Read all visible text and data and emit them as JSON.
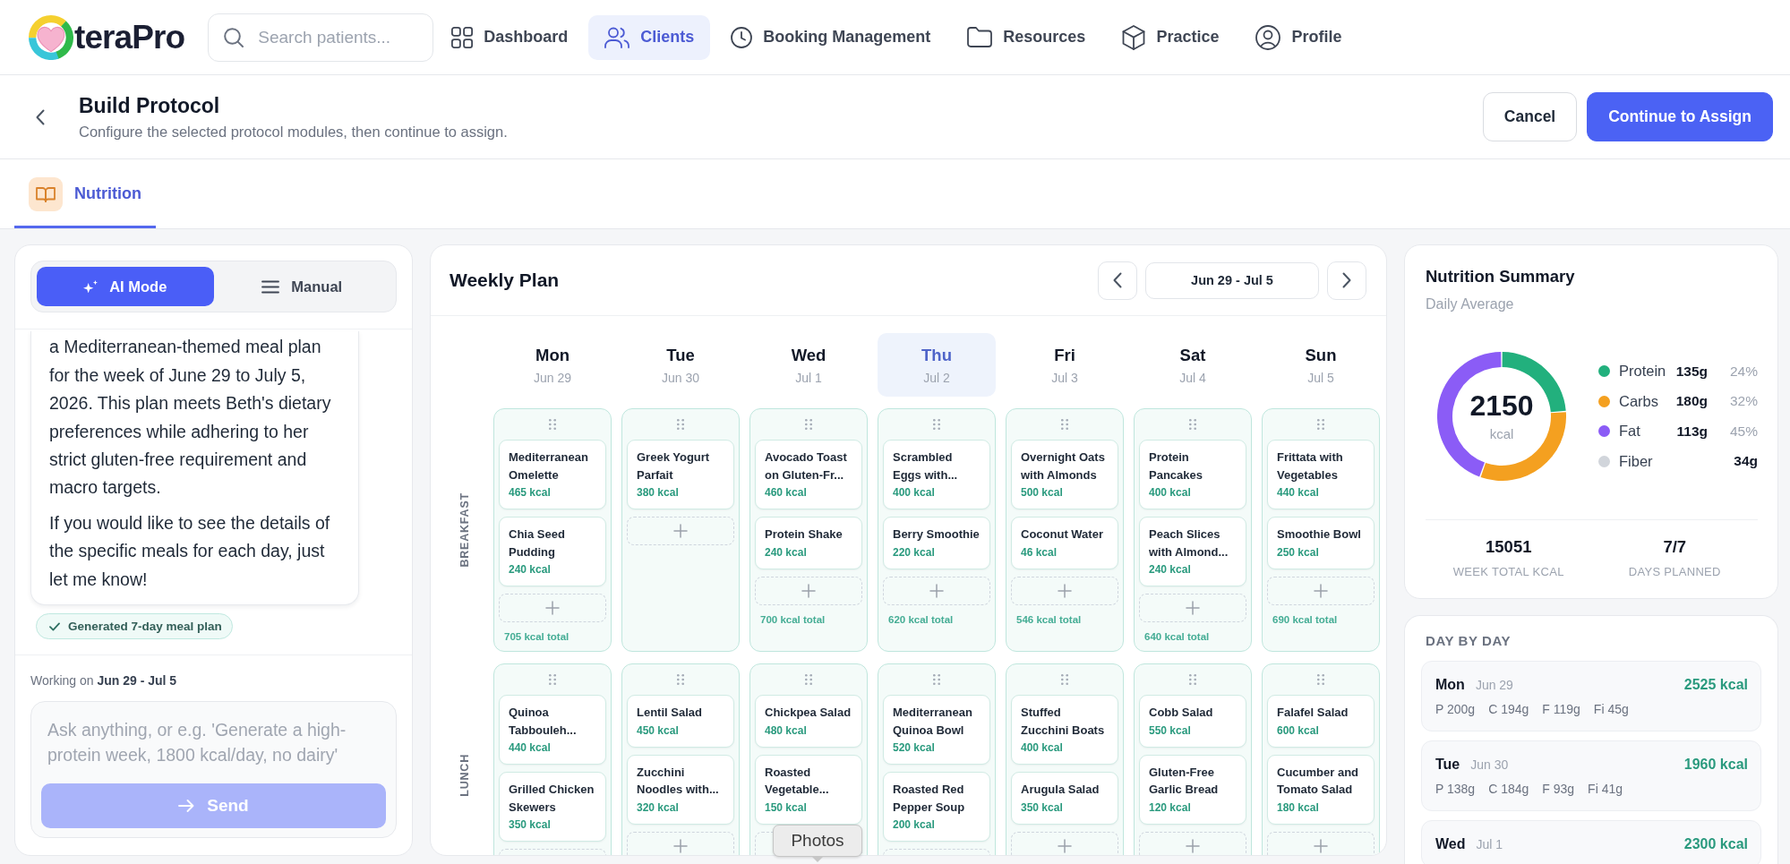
{
  "app": {
    "name": "teraPro"
  },
  "search": {
    "placeholder": "Search patients..."
  },
  "nav": {
    "items": [
      {
        "label": "Dashboard",
        "selected": false
      },
      {
        "label": "Clients",
        "selected": true
      },
      {
        "label": "Booking Management",
        "selected": false
      },
      {
        "label": "Resources",
        "selected": false
      },
      {
        "label": "Practice",
        "selected": false
      },
      {
        "label": "Profile",
        "selected": false
      }
    ]
  },
  "page_header": {
    "title": "Build Protocol",
    "subtitle": "Configure the selected protocol modules, then continue to assign.",
    "buttons": [
      {
        "label": "Cancel",
        "kind": "secondary"
      },
      {
        "label": "Continue to Assign",
        "kind": "primary"
      }
    ]
  },
  "tabs": [
    {
      "label": "Nutrition",
      "selected": true
    }
  ],
  "assistant": {
    "mode_toggle": [
      {
        "label": "AI Mode",
        "selected": true
      },
      {
        "label": "Manual",
        "selected": false
      }
    ],
    "messages": [
      {
        "paragraphs": [
          "a Mediterranean-themed meal plan for the week of June 29 to July 5, 2026. This plan meets Beth's dietary preferences while adhering to her strict gluten-free requirement and macro targets.",
          "If you would like to see the details of the specific meals for each day, just let me know!"
        ]
      }
    ],
    "status_chip": "Generated 7-day meal plan",
    "context": "Working on **Jun 29 - Jul 5**",
    "composer": {
      "placeholder": "Ask anything, or e.g. 'Generate a high-protein week, 1800 kcal/day, no dairy'",
      "send_button": {
        "label": "Send",
        "disabled": true
      }
    }
  },
  "weekly_plan": {
    "title": "Weekly Plan",
    "range": "Jun 29 - Jul 5",
    "days": [
      {
        "name": "Mon",
        "date": "Jun 29",
        "selected": false
      },
      {
        "name": "Tue",
        "date": "Jun 30",
        "selected": false
      },
      {
        "name": "Wed",
        "date": "Jul 1",
        "selected": false
      },
      {
        "name": "Thu",
        "date": "Jul 2",
        "selected": true
      },
      {
        "name": "Fri",
        "date": "Jul 3",
        "selected": false
      },
      {
        "name": "Sat",
        "date": "Jul 4",
        "selected": false
      },
      {
        "name": "Sun",
        "date": "Jul 5",
        "selected": false
      }
    ],
    "meal_rows": [
      {
        "label": "BREAKFAST",
        "slots": [
          {
            "meals": [
              {
                "name": "Mediterranean Omelette",
                "kcal": "465 kcal"
              },
              {
                "name": "Chia Seed Pudding",
                "kcal": "240 kcal"
              }
            ],
            "total": "705 kcal total"
          },
          {
            "meals": [
              {
                "name": "Greek Yogurt Parfait",
                "kcal": "380 kcal"
              }
            ]
          },
          {
            "meals": [
              {
                "name": "Avocado Toast on Gluten-Fr...",
                "kcal": "460 kcal"
              },
              {
                "name": "Protein Shake",
                "kcal": "240 kcal"
              }
            ],
            "total": "700 kcal total"
          },
          {
            "meals": [
              {
                "name": "Scrambled Eggs with...",
                "kcal": "400 kcal"
              },
              {
                "name": "Berry Smoothie",
                "kcal": "220 kcal"
              }
            ],
            "total": "620 kcal total"
          },
          {
            "meals": [
              {
                "name": "Overnight Oats with Almonds",
                "kcal": "500 kcal"
              },
              {
                "name": "Coconut Water",
                "kcal": "46 kcal"
              }
            ],
            "total": "546 kcal total"
          },
          {
            "meals": [
              {
                "name": "Protein Pancakes",
                "kcal": "400 kcal"
              },
              {
                "name": "Peach Slices with Almond...",
                "kcal": "240 kcal"
              }
            ],
            "total": "640 kcal total"
          },
          {
            "meals": [
              {
                "name": "Frittata with Vegetables",
                "kcal": "440 kcal"
              },
              {
                "name": "Smoothie Bowl",
                "kcal": "250 kcal"
              }
            ],
            "total": "690 kcal total"
          }
        ]
      },
      {
        "label": "LUNCH",
        "slots": [
          {
            "meals": [
              {
                "name": "Quinoa Tabbouleh...",
                "kcal": "440 kcal"
              },
              {
                "name": "Grilled Chicken Skewers",
                "kcal": "350 kcal"
              }
            ]
          },
          {
            "meals": [
              {
                "name": "Lentil Salad",
                "kcal": "450 kcal"
              },
              {
                "name": "Zucchini Noodles with...",
                "kcal": "320 kcal"
              }
            ]
          },
          {
            "meals": [
              {
                "name": "Chickpea Salad",
                "kcal": "480 kcal"
              },
              {
                "name": "Roasted Vegetable...",
                "kcal": "150 kcal"
              }
            ]
          },
          {
            "meals": [
              {
                "name": "Mediterranean Quinoa Bowl",
                "kcal": "520 kcal"
              },
              {
                "name": "Roasted Red Pepper Soup",
                "kcal": "200 kcal"
              }
            ]
          },
          {
            "meals": [
              {
                "name": "Stuffed Zucchini Boats",
                "kcal": "400 kcal"
              },
              {
                "name": "Arugula Salad",
                "kcal": "350 kcal"
              }
            ]
          },
          {
            "meals": [
              {
                "name": "Cobb Salad",
                "kcal": "550 kcal"
              },
              {
                "name": "Gluten-Free Garlic Bread",
                "kcal": "120 kcal"
              }
            ]
          },
          {
            "meals": [
              {
                "name": "Falafel Salad",
                "kcal": "600 kcal"
              },
              {
                "name": "Cucumber and Tomato Salad",
                "kcal": "180 kcal"
              }
            ]
          }
        ]
      }
    ]
  },
  "nutrition_summary": {
    "title": "Nutrition Summary",
    "subtitle": "Daily Average",
    "center_value": "2150",
    "center_unit": "kcal",
    "chart_data": {
      "type": "donut",
      "values": [
        24,
        32,
        45
      ]
    },
    "legend": [
      {
        "name": "Protein",
        "grams": "135g",
        "percent": "24%",
        "color": "#22b07d"
      },
      {
        "name": "Carbs",
        "grams": "180g",
        "percent": "32%",
        "color": "#f4a020"
      },
      {
        "name": "Fat",
        "grams": "113g",
        "percent": "45%",
        "color": "#8b5cf6"
      },
      {
        "name": "Fiber",
        "grams": "34g",
        "color": "#d1d5db"
      }
    ],
    "stats": [
      {
        "value": "15051",
        "label": "WEEK TOTAL KCAL"
      },
      {
        "value": "7/7",
        "label": "DAYS PLANNED"
      }
    ]
  },
  "day_by_day": {
    "title": "DAY BY DAY",
    "days": [
      {
        "day": "Mon",
        "date": "Jun 29",
        "kcal": "2525 kcal",
        "macros": [
          "P 200g",
          "C 194g",
          "F 119g",
          "Fi 45g"
        ]
      },
      {
        "day": "Tue",
        "date": "Jun 30",
        "kcal": "1960 kcal",
        "macros": [
          "P 138g",
          "C 184g",
          "F 93g",
          "Fi 41g"
        ]
      },
      {
        "day": "Wed",
        "date": "Jul 1",
        "kcal": "2300 kcal"
      }
    ]
  },
  "tooltip": {
    "text": "Photos"
  }
}
